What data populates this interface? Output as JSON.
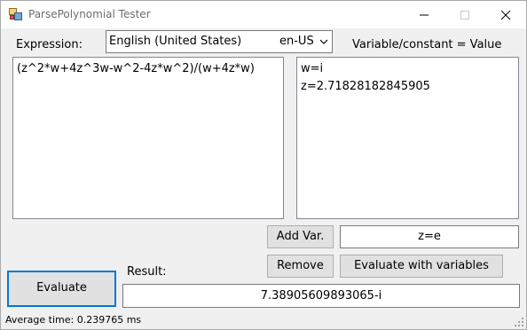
{
  "window": {
    "title": "ParsePolynomial Tester"
  },
  "expression": {
    "label": "Expression:",
    "value": "(z^2*w+4z^3w-w^2-4z*w^2)/(w+4z*w)"
  },
  "culture": {
    "selected_name": "English (United States)",
    "selected_code": "en-US"
  },
  "variables": {
    "header": "Variable/constant  = Value",
    "lines": [
      "w=i",
      "z=2.71828182845905"
    ]
  },
  "buttons": {
    "add_var": "Add Var.",
    "remove": "Remove",
    "evaluate_with_variables": "Evaluate with variables",
    "evaluate": "Evaluate"
  },
  "new_variable": {
    "value": "z=e"
  },
  "result": {
    "label": "Result:",
    "value": "7.38905609893065-i"
  },
  "status": {
    "text": "Average time: 0.239765 ms"
  }
}
